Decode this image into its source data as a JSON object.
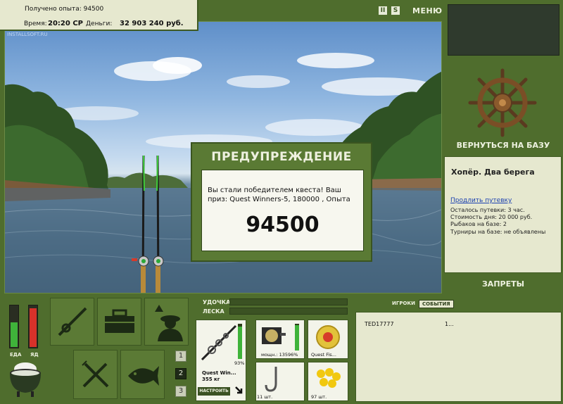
{
  "status": {
    "experience_label": "Получено опыта: 94500",
    "time_label": "Время:",
    "time_value": "20:20 СР",
    "money_label": "Деньги:",
    "money_value": "32 903 240 руб.",
    "watermark": "INSTALLSOFT.RU"
  },
  "top_controls": {
    "pause_label": "II",
    "sound_label": "S",
    "menu_label": "МЕНЮ"
  },
  "dialog": {
    "title": "ПРЕДУПРЕЖДЕНИЕ",
    "message": "Вы стали победителем квеста! Ваш приз: Quest Winners-5, 180000 , Опыта",
    "value": "94500"
  },
  "right_panel": {
    "back_label": "ВЕРНУТЬСЯ НА БАЗУ",
    "location": "Хопёр. Два берега",
    "extend_link": "Продлить путевку",
    "lines": [
      "Осталось путевки: 3 час.",
      "Стоимость дня: 20 000 руб.",
      "Рыбаков на базе: 2",
      "Турниры на базе: не объявлены"
    ],
    "bans_label": "ЗАПРЕТЫ"
  },
  "needs": {
    "food_label": "ЕДА",
    "alcohol_label": "ЯД",
    "food_level": 0.6,
    "alcohol_level": 0.95
  },
  "slots": [
    "1",
    "2",
    "3"
  ],
  "tackle": {
    "rod_label": "УДОЧКА",
    "line_label": "ЛЕСКА",
    "rod_name": "Quest Win...",
    "rod_weight": "355 кг",
    "rod_percent": "93%",
    "rod_level": 0.93,
    "setup_label": "НАСТРОИТЬ",
    "reel_label": "мощн.: 135",
    "reel_percent": "96%",
    "reel_level": 0.96,
    "line_name": "Quest Fis...",
    "hook_count": "11 шт.",
    "bait_count": "97 шт."
  },
  "events": {
    "tab_players": "ИГРОКИ",
    "tab_events": "СОБЫТИЯ",
    "rows": [
      {
        "name": "TED17777",
        "value": "1..."
      }
    ]
  },
  "colors": {
    "panel_green": "#4f6d2d",
    "panel_beige": "#e6e8cf",
    "bar_green": "#3fb33a",
    "bar_red": "#d8322a"
  }
}
